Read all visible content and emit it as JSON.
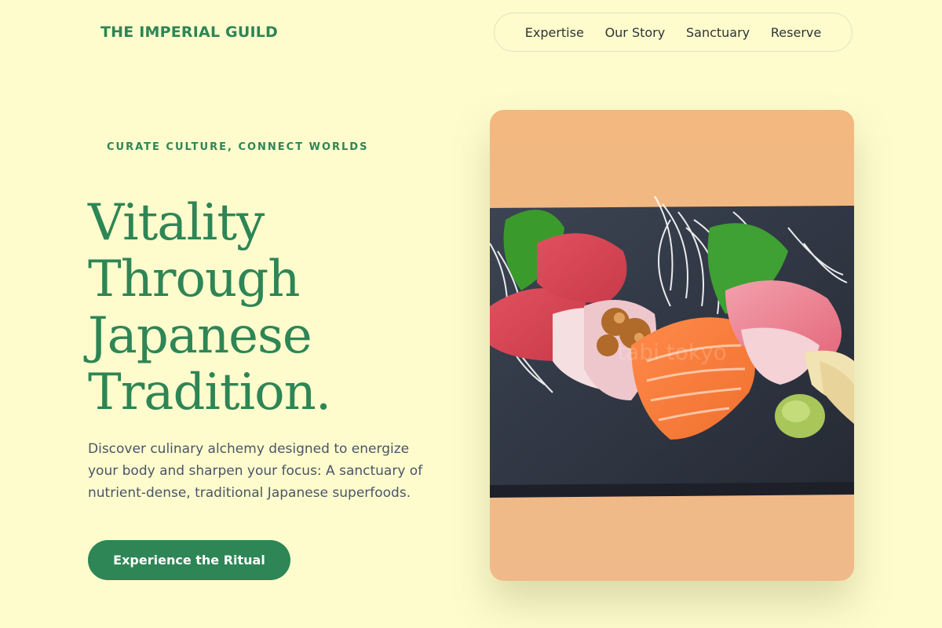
{
  "brand": {
    "name": "THE IMPERIAL GUILD"
  },
  "nav": {
    "items": [
      {
        "label": "Expertise"
      },
      {
        "label": "Our Story"
      },
      {
        "label": "Sanctuary"
      },
      {
        "label": "Reserve"
      }
    ]
  },
  "hero": {
    "eyebrow": "CURATE CULTURE, CONNECT WORLDS",
    "headline_lines": [
      "Vitality",
      "Through",
      "Japanese",
      "Tradition."
    ],
    "description": "Discover culinary alchemy designed to energize your body and sharpen your focus: A sanctuary of nutrient-dense, traditional Japanese superfoods.",
    "cta_label": "Experience the Ritual",
    "image": {
      "subject": "sashimi-plate",
      "watermark": "tabi tokyo"
    }
  },
  "colors": {
    "background": "#fefccd",
    "accent": "#2e8555",
    "text_body": "#4a5568",
    "nav_text": "#2d3436"
  }
}
